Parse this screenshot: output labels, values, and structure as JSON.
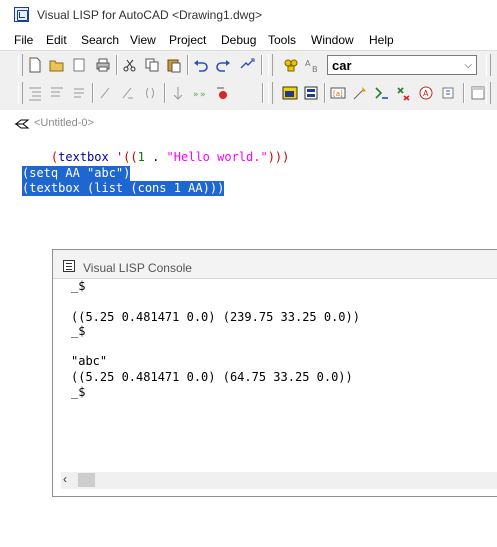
{
  "window": {
    "title": "Visual LISP for AutoCAD <Drawing1.dwg>"
  },
  "menu": [
    "File",
    "Edit",
    "Search",
    "View",
    "Project",
    "Debug",
    "Tools",
    "Window",
    "Help"
  ],
  "toolbar": {
    "search_combo_value": "car"
  },
  "editor": {
    "tab_label": "<Untitled-0>",
    "line1": {
      "open": "(",
      "fn": "textbox",
      "mid": " '((",
      "num": "1",
      "dot": " . ",
      "str": "\"Hello world.\"",
      "close": ")))"
    },
    "line3": "(setq AA \"abc\")",
    "line4": "(textbox (list (cons 1 AA)))"
  },
  "console": {
    "title": "Visual LISP Console",
    "lines": [
      "_$",
      "",
      "((5.25 0.481471 0.0) (239.75 33.25 0.0))",
      "_$",
      "",
      "\"abc\"",
      "((5.25 0.481471 0.0) (64.75 33.25 0.0))",
      "_$"
    ]
  }
}
